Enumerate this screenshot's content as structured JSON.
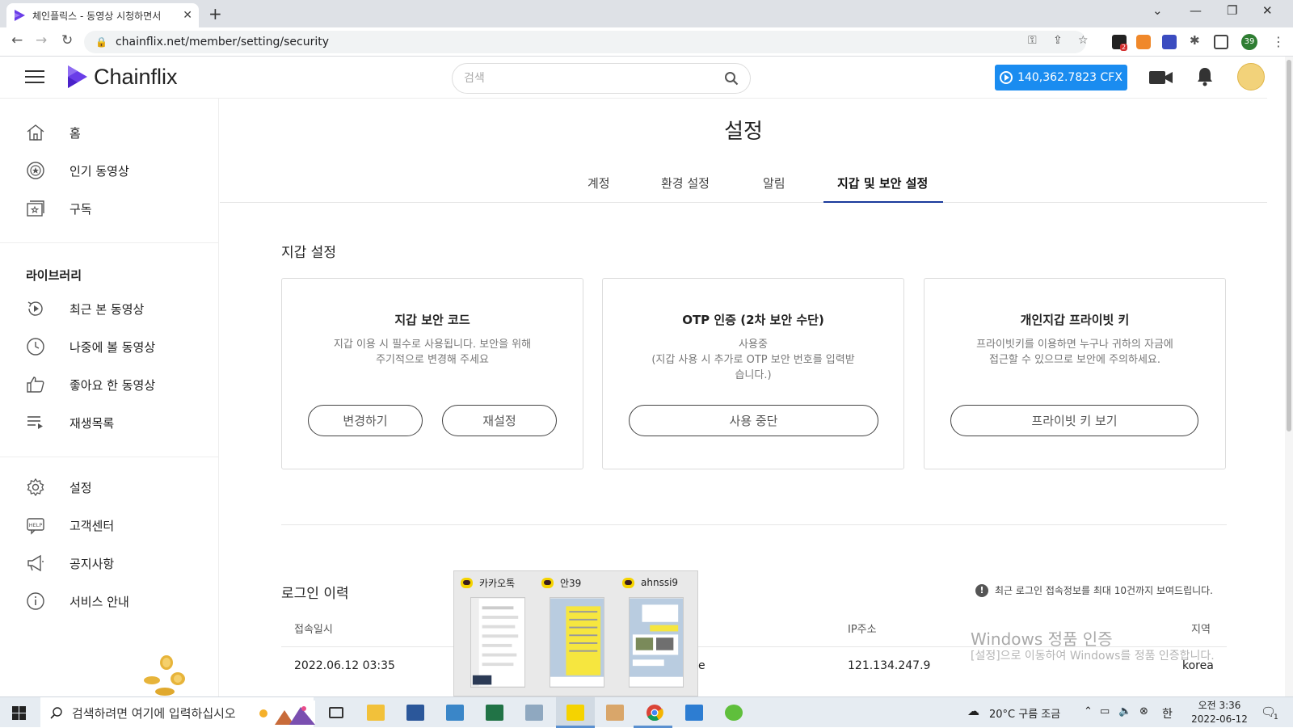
{
  "browser": {
    "tab_title": "체인플릭스 - 동영상 시청하면서",
    "url": "chainflix.net/member/setting/security",
    "new_tab_label": "+",
    "profile_initial": "39",
    "ext_badge": "2"
  },
  "header": {
    "logo_text": "Chainflix",
    "search_placeholder": "검색",
    "balance": "140,362.7823 CFX"
  },
  "sidebar": {
    "items": [
      {
        "label": "홈",
        "icon": "home-icon"
      },
      {
        "label": "인기 동영상",
        "icon": "trending-icon"
      },
      {
        "label": "구독",
        "icon": "subscription-icon"
      }
    ],
    "library_heading": "라이브러리",
    "library_items": [
      {
        "label": "최근 본 동영상",
        "icon": "history-icon"
      },
      {
        "label": "나중에 볼 동영상",
        "icon": "clock-icon"
      },
      {
        "label": "좋아요 한 동영상",
        "icon": "thumbs-up-icon"
      },
      {
        "label": "재생목록",
        "icon": "playlist-icon"
      }
    ],
    "bottom_items": [
      {
        "label": "설정",
        "icon": "gear-icon"
      },
      {
        "label": "고객센터",
        "icon": "help-icon"
      },
      {
        "label": "공지사항",
        "icon": "megaphone-icon"
      },
      {
        "label": "서비스 안내",
        "icon": "info-icon"
      }
    ]
  },
  "main": {
    "title": "설정",
    "tabs": [
      {
        "label": "계정"
      },
      {
        "label": "환경 설정"
      },
      {
        "label": "알림"
      },
      {
        "label": "지갑 및 보안 설정",
        "active": true
      }
    ],
    "wallet_section_title": "지갑 설정",
    "cards": [
      {
        "title": "지갑 보안 코드",
        "desc": "지갑 이용 시 필수로 사용됩니다. 보안을 위해\n주기적으로 변경해 주세요",
        "buttons": [
          "변경하기",
          "재설정"
        ]
      },
      {
        "title": "OTP 인증 (2차 보안 수단)",
        "desc": "사용중\n(지갑 사용 시 추가로 OTP 보안 번호를 입력받\n습니다.)",
        "buttons": [
          "사용 중단"
        ]
      },
      {
        "title": "개인지갑 프라이빗 키",
        "desc": "프라이빗키를 이용하면 누구나 귀하의 자금에\n접근할 수 있으므로 보안에 주의하세요.",
        "buttons": [
          "프라이빗 키 보기"
        ]
      }
    ],
    "login_history": {
      "title": "로그인 이력",
      "notice": "최근 로그인 접속정보를 최대 10건까지 보여드립니다.",
      "columns": [
        "접속일시",
        "IP주소",
        "지역"
      ],
      "rows": [
        {
          "datetime": "2022.06.12 03:35",
          "partial": "e",
          "ip": "121.134.247.9",
          "region": "korea"
        }
      ]
    }
  },
  "watermark": {
    "line1": "Windows 정품 인증",
    "line2": "[설정]으로 이동하여 Windows를 정품 인증합니다."
  },
  "kakao_popup": {
    "previews": [
      {
        "label": "카카오톡"
      },
      {
        "label": "안39"
      },
      {
        "label": "ahnssi9"
      }
    ]
  },
  "taskbar": {
    "search_placeholder": "검색하려면 여기에 입력하십시오",
    "weather": "20°C  구름 조금",
    "ime": "한",
    "time": "오전 3:36",
    "date": "2022-06-12",
    "notification_count": "1"
  },
  "colors": {
    "accent_blue": "#1a8cf0",
    "tab_underline": "#1a3a9c",
    "logo_purple": "#6a3de8"
  }
}
